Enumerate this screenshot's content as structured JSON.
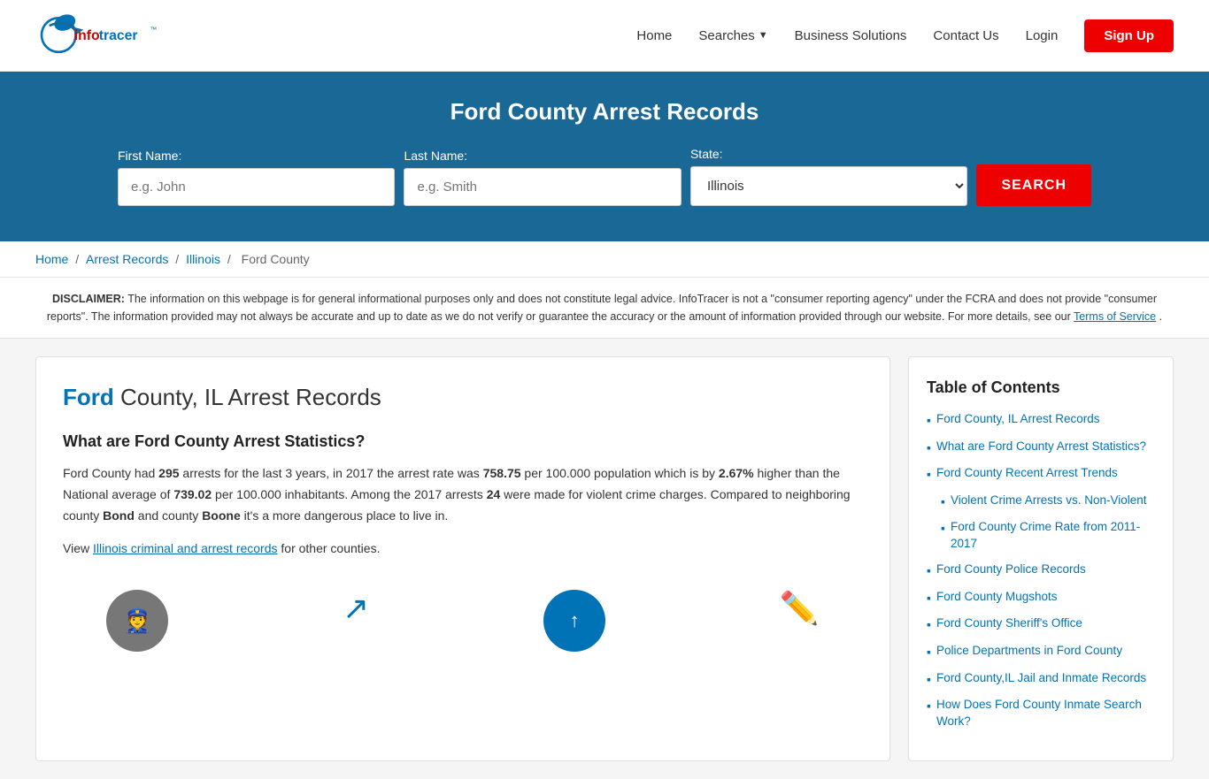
{
  "header": {
    "logo_text": "infotracer",
    "logo_trademark": "™",
    "nav": {
      "home": "Home",
      "searches": "Searches",
      "business_solutions": "Business Solutions",
      "contact_us": "Contact Us",
      "login": "Login",
      "signup": "Sign Up"
    }
  },
  "hero": {
    "title": "Ford County Arrest Records",
    "form": {
      "first_name_label": "First Name:",
      "first_name_placeholder": "e.g. John",
      "last_name_label": "Last Name:",
      "last_name_placeholder": "e.g. Smith",
      "state_label": "State:",
      "state_value": "Illinois",
      "search_button": "SEARCH"
    }
  },
  "breadcrumb": {
    "home": "Home",
    "arrest_records": "Arrest Records",
    "illinois": "Illinois",
    "ford_county": "Ford County"
  },
  "disclaimer": {
    "prefix": "DISCLAIMER:",
    "text": " The information on this webpage is for general informational purposes only and does not constitute legal advice. InfoTracer is not a \"consumer reporting agency\" under the FCRA and does not provide \"consumer reports\". The information provided may not always be accurate and up to date as we do not verify or guarantee the accuracy or the amount of information provided through our website. For more details, see our ",
    "link": "Terms of Service",
    "suffix": "."
  },
  "article": {
    "title_highlight": "Ford",
    "title_rest": " County, IL Arrest Records",
    "section1_heading": "What are Ford County Arrest Statistics?",
    "paragraph1": "Ford County had 295 arrests for the last 3 years, in 2017 the arrest rate was 758.75 per 100.000 population which is by 2.67% higher than the National average of 739.02 per 100.000 inhabitants. Among the 2017 arrests 24 were made for violent crime charges. Compared to neighboring county Bond and county Boone it's a more dangerous place to live in.",
    "paragraph1_bold": [
      "295",
      "758.75",
      "2.67%",
      "739.02",
      "24",
      "Bond",
      "Boone"
    ],
    "paragraph2_prefix": "View ",
    "paragraph2_link": "Illinois criminal and arrest records",
    "paragraph2_suffix": " for other counties."
  },
  "toc": {
    "title": "Table of Contents",
    "items": [
      {
        "label": "Ford County, IL Arrest Records",
        "sub": false
      },
      {
        "label": "What are Ford County Arrest Statistics?",
        "sub": false
      },
      {
        "label": "Ford County Recent Arrest Trends",
        "sub": false
      },
      {
        "label": "Violent Crime Arrests vs. Non-Violent",
        "sub": true
      },
      {
        "label": "Ford County Crime Rate from 2011-2017",
        "sub": true
      },
      {
        "label": "Ford County Police Records",
        "sub": false
      },
      {
        "label": "Ford County Mugshots",
        "sub": false
      },
      {
        "label": "Ford County Sheriff's Office",
        "sub": false
      },
      {
        "label": "Police Departments in Ford County",
        "sub": false
      },
      {
        "label": "Ford County,IL Jail and Inmate Records",
        "sub": false
      },
      {
        "label": "How Does Ford County Inmate Search Work?",
        "sub": false
      }
    ]
  },
  "colors": {
    "primary_blue": "#1a6896",
    "link_blue": "#0073b7",
    "red": "#cc0000"
  }
}
